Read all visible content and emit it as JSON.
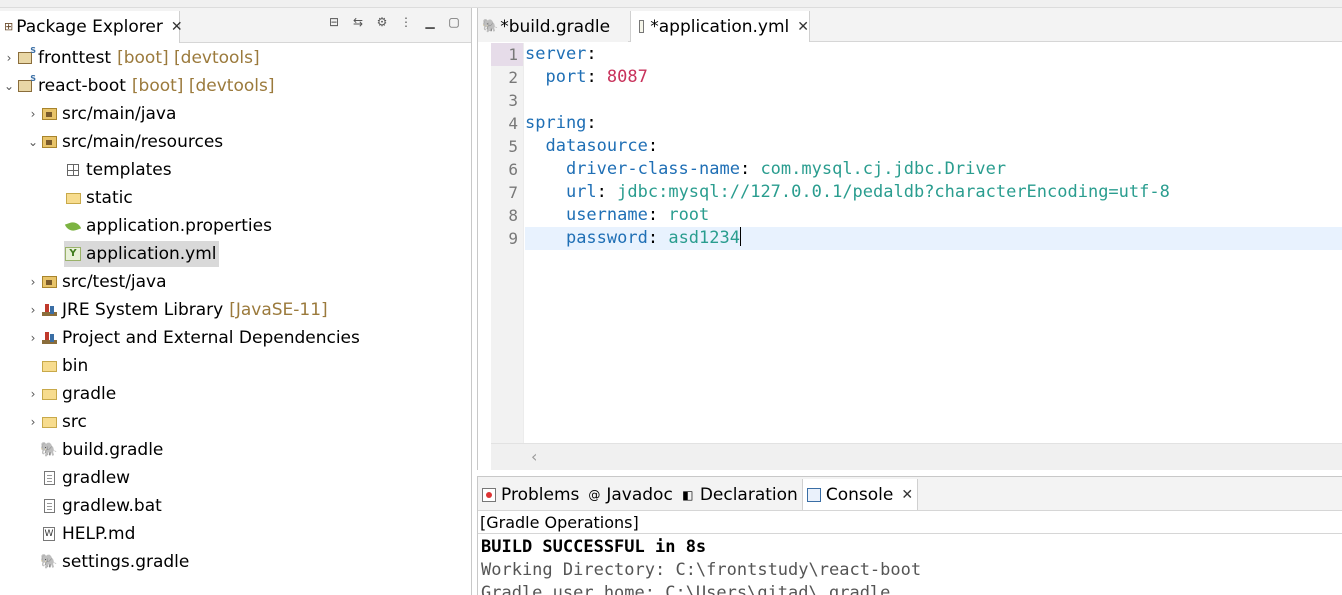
{
  "explorer": {
    "title": "Package Explorer",
    "close": "✕",
    "tree": [
      {
        "label": "fronttest",
        "decor": "[boot] [devtools]",
        "arrow": "›",
        "icon": "project-icon",
        "depth": 0
      },
      {
        "label": "react-boot",
        "decor": "[boot] [devtools]",
        "arrow": "⌄",
        "icon": "project-icon",
        "depth": 0
      },
      {
        "label": "src/main/java",
        "decor": "",
        "arrow": "›",
        "icon": "source-folder-icon",
        "depth": 1
      },
      {
        "label": "src/main/resources",
        "decor": "",
        "arrow": "⌄",
        "icon": "source-folder-icon",
        "depth": 1
      },
      {
        "label": "templates",
        "decor": "",
        "arrow": "",
        "icon": "package-grid-icon",
        "depth": 2
      },
      {
        "label": "static",
        "decor": "",
        "arrow": "",
        "icon": "folder-icon",
        "depth": 2
      },
      {
        "label": "application.properties",
        "decor": "",
        "arrow": "",
        "icon": "spring-leaf-icon",
        "depth": 2
      },
      {
        "label": "application.yml",
        "decor": "",
        "arrow": "",
        "icon": "yml-file-icon",
        "depth": 2,
        "selected": true
      },
      {
        "label": "src/test/java",
        "decor": "",
        "arrow": "›",
        "icon": "source-folder-icon",
        "depth": 1
      },
      {
        "label": "JRE System Library",
        "decor": "[JavaSE-11]",
        "arrow": "›",
        "icon": "library-icon",
        "depth": 1
      },
      {
        "label": "Project and External Dependencies",
        "decor": "",
        "arrow": "›",
        "icon": "library-icon",
        "depth": 1
      },
      {
        "label": "bin",
        "decor": "",
        "arrow": "",
        "icon": "folder-icon",
        "depth": 1
      },
      {
        "label": "gradle",
        "decor": "",
        "arrow": "›",
        "icon": "folder-icon",
        "depth": 1
      },
      {
        "label": "src",
        "decor": "",
        "arrow": "›",
        "icon": "folder-icon",
        "depth": 1
      },
      {
        "label": "build.gradle",
        "decor": "",
        "arrow": "",
        "icon": "gradle-elephant-icon",
        "depth": 1
      },
      {
        "label": "gradlew",
        "decor": "",
        "arrow": "",
        "icon": "text-file-icon",
        "depth": 1
      },
      {
        "label": "gradlew.bat",
        "decor": "",
        "arrow": "",
        "icon": "text-file-icon",
        "depth": 1
      },
      {
        "label": "HELP.md",
        "decor": "",
        "arrow": "",
        "icon": "markdown-file-icon",
        "depth": 1
      },
      {
        "label": "settings.gradle",
        "decor": "",
        "arrow": "",
        "icon": "gradle-elephant-icon",
        "depth": 1
      }
    ]
  },
  "editor": {
    "tabs": [
      {
        "label": "*build.gradle",
        "icon": "gradle-elephant-icon"
      },
      {
        "label": "*application.yml",
        "icon": "yml-file-icon",
        "close": "✕"
      }
    ],
    "lines": [
      {
        "num": "1",
        "parts": [
          {
            "t": "server",
            "c": "k"
          },
          {
            "t": ":",
            "c": "p"
          }
        ]
      },
      {
        "num": "2",
        "parts": [
          {
            "t": "  ",
            "c": "p"
          },
          {
            "t": "port",
            "c": "k"
          },
          {
            "t": ": ",
            "c": "p"
          },
          {
            "t": "8087",
            "c": "n"
          }
        ]
      },
      {
        "num": "3",
        "parts": []
      },
      {
        "num": "4",
        "parts": [
          {
            "t": "spring",
            "c": "k"
          },
          {
            "t": ":",
            "c": "p"
          }
        ]
      },
      {
        "num": "5",
        "parts": [
          {
            "t": "  ",
            "c": "p"
          },
          {
            "t": "datasource",
            "c": "k"
          },
          {
            "t": ":",
            "c": "p"
          }
        ]
      },
      {
        "num": "6",
        "parts": [
          {
            "t": "    ",
            "c": "p"
          },
          {
            "t": "driver-class-name",
            "c": "k"
          },
          {
            "t": ": ",
            "c": "p"
          },
          {
            "t": "com.mysql.cj.jdbc.Driver",
            "c": "v"
          }
        ]
      },
      {
        "num": "7",
        "parts": [
          {
            "t": "    ",
            "c": "p"
          },
          {
            "t": "url",
            "c": "k"
          },
          {
            "t": ": ",
            "c": "p"
          },
          {
            "t": "jdbc:mysql://127.0.0.1/pedaldb?characterEncoding=utf-8",
            "c": "v"
          }
        ]
      },
      {
        "num": "8",
        "parts": [
          {
            "t": "    ",
            "c": "p"
          },
          {
            "t": "username",
            "c": "k"
          },
          {
            "t": ": ",
            "c": "p"
          },
          {
            "t": "root",
            "c": "v"
          }
        ]
      },
      {
        "num": "9",
        "parts": [
          {
            "t": "    ",
            "c": "p"
          },
          {
            "t": "password",
            "c": "k"
          },
          {
            "t": ": ",
            "c": "p"
          },
          {
            "t": "asd1234",
            "c": "v"
          }
        ],
        "current": true
      }
    ]
  },
  "bottom": {
    "tabs": [
      {
        "label": "Problems",
        "icon": "problems-icon"
      },
      {
        "label": "Javadoc",
        "icon": "javadoc-at-icon"
      },
      {
        "label": "Declaration",
        "icon": "declaration-icon"
      },
      {
        "label": "Console",
        "icon": "console-icon",
        "active": true,
        "close": "✕"
      }
    ],
    "subtitle": "[Gradle Operations]",
    "output": [
      {
        "text": "BUILD SUCCESSFUL in 8s",
        "style": "bold"
      },
      {
        "text": "Working Directory: C:\\frontstudy\\react-boot",
        "style": "grey"
      },
      {
        "text": "Gradle user home: C:\\Users\\gitad\\.gradle",
        "style": "grey"
      }
    ]
  },
  "colors": {
    "yaml_key": "#1f6fb5",
    "yaml_string": "#2a9d8f",
    "yaml_number": "#c8325b",
    "decoration": "#9b7a3c",
    "current_line": "#e8f2fe"
  }
}
